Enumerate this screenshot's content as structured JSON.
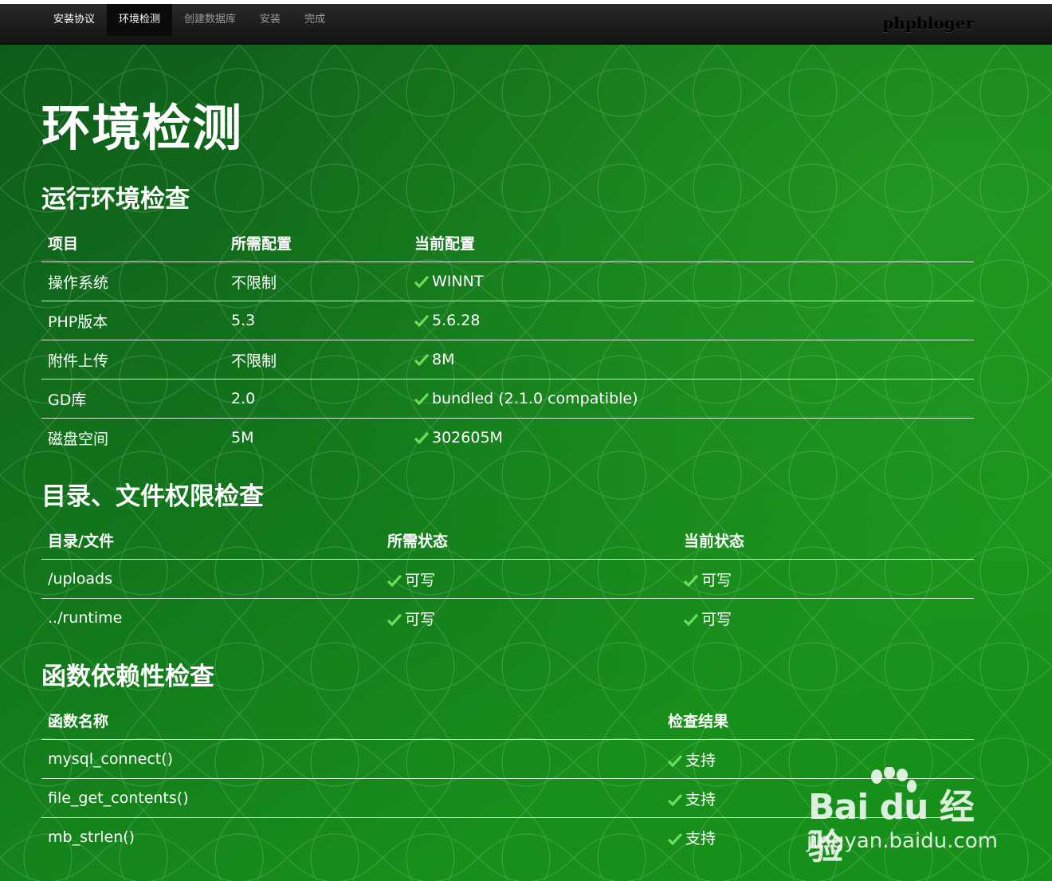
{
  "nav": {
    "items": [
      {
        "label": "安装协议"
      },
      {
        "label": "环境检测"
      },
      {
        "label": "创建数据库"
      },
      {
        "label": "安装"
      },
      {
        "label": "完成"
      }
    ],
    "brand": "phpbloger"
  },
  "page": {
    "title": "环境检测"
  },
  "env_check": {
    "title": "运行环境检查",
    "headers": [
      "项目",
      "所需配置",
      "当前配置"
    ],
    "rows": [
      {
        "item": "操作系统",
        "required": "不限制",
        "current": "WINNT"
      },
      {
        "item": "PHP版本",
        "required": "5.3",
        "current": "5.6.28"
      },
      {
        "item": "附件上传",
        "required": "不限制",
        "current": "8M"
      },
      {
        "item": "GD库",
        "required": "2.0",
        "current": "bundled (2.1.0 compatible)"
      },
      {
        "item": "磁盘空间",
        "required": "5M",
        "current": "302605M"
      }
    ]
  },
  "dir_check": {
    "title": "目录、文件权限检查",
    "headers": [
      "目录/文件",
      "所需状态",
      "当前状态"
    ],
    "rows": [
      {
        "path": "/uploads",
        "required": "可写",
        "current": "可写"
      },
      {
        "path": "../runtime",
        "required": "可写",
        "current": "可写"
      }
    ]
  },
  "func_check": {
    "title": "函数依赖性检查",
    "headers": [
      "函数名称",
      "检查结果"
    ],
    "rows": [
      {
        "name": "mysql_connect()",
        "result": "支持"
      },
      {
        "name": "file_get_contents()",
        "result": "支持"
      },
      {
        "name": "mb_strlen()",
        "result": "支持"
      }
    ]
  },
  "watermark": {
    "brand": "Bai du 经验",
    "url": "jingyan.baidu.com"
  },
  "colors": {
    "background_green": "#17881b",
    "navbar": "#1a1a1a",
    "check_mark": "#6dde5a"
  },
  "icons": {
    "check": "check-icon"
  }
}
